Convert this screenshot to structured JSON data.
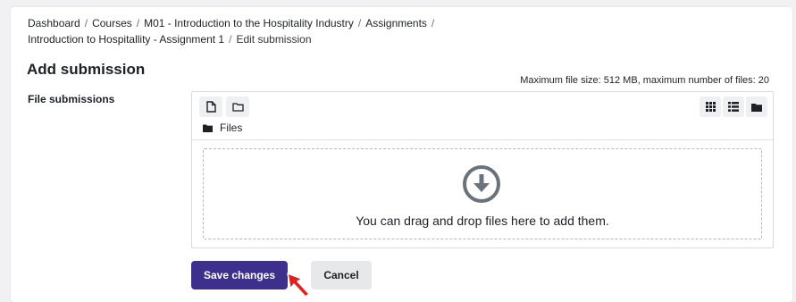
{
  "breadcrumb": {
    "items": [
      "Dashboard",
      "Courses",
      "M01 - Introduction to the Hospitality Industry",
      "Assignments",
      "Introduction to Hospitallity - Assignment 1",
      "Edit submission"
    ],
    "separator": "/"
  },
  "page": {
    "title": "Add submission"
  },
  "form": {
    "limits_text": "Maximum file size: 512 MB, maximum number of files: 20",
    "file_submissions_label": "File submissions",
    "filemanager": {
      "toolbar_icons": [
        "add-file-icon",
        "create-folder-icon"
      ],
      "view_icons": [
        "icons-view-icon",
        "list-view-icon",
        "tree-view-icon"
      ],
      "path_label": "Files",
      "dropzone_text": "You can drag and drop files here to add them."
    },
    "save_label": "Save changes",
    "cancel_label": "Cancel"
  },
  "colors": {
    "primary": "#3d2f8c",
    "secondary": "#e7e8ea",
    "background": "#f1f1f3",
    "cursor": "#e0201b"
  }
}
